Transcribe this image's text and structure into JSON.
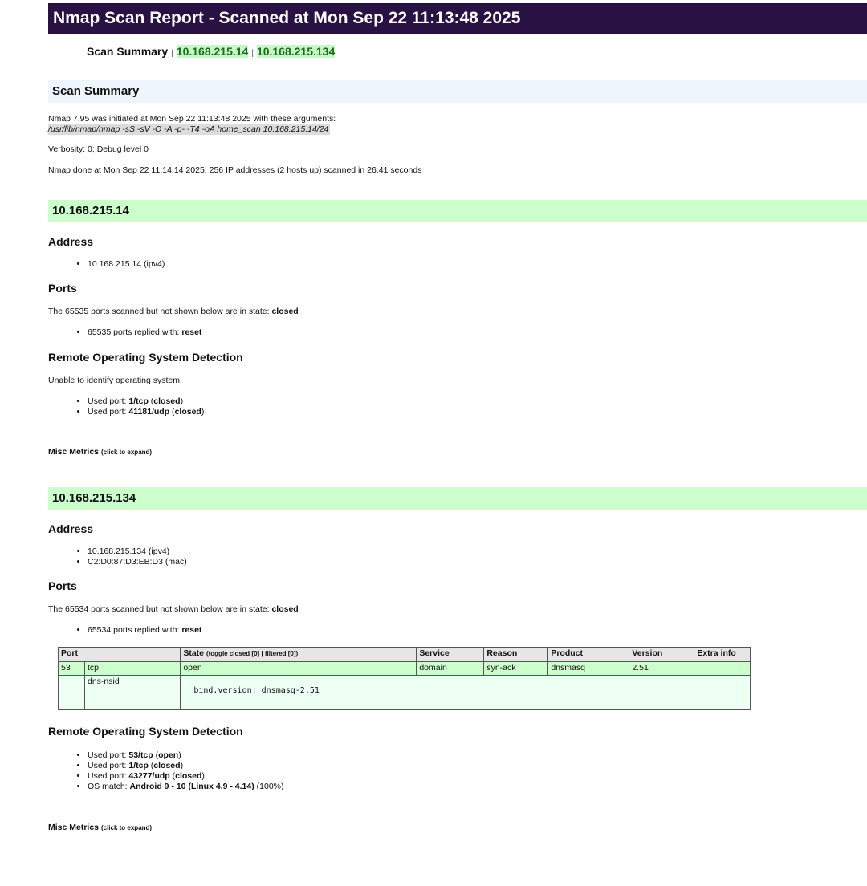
{
  "title": "Nmap Scan Report - Scanned at Mon Sep 22 11:13:48 2025",
  "nav": {
    "summary": "Scan Summary",
    "sep": "|",
    "hosts": [
      "10.168.215.14",
      "10.168.215.134"
    ]
  },
  "summary": {
    "heading": "Scan Summary",
    "line1": "Nmap 7.95 was initiated at Mon Sep 22 11:13:48 2025 with these arguments:",
    "args": "/usr/lib/nmap/nmap -sS -sV -O -A -p- -T4 -oA home_scan 10.168.215.14/24",
    "verbosity": "Verbosity: 0; Debug level 0",
    "done": "Nmap done at Mon Sep 22 11:14:14 2025; 256 IP addresses (2 hosts up) scanned in 26.41 seconds"
  },
  "host1": {
    "heading": "10.168.215.14",
    "address_title": "Address",
    "addresses": [
      "10.168.215.14 (ipv4)"
    ],
    "ports_title": "Ports",
    "ports_text": "The 65535 ports scanned but not shown below are in state: ",
    "ports_state": "closed",
    "replied_text": "65535 ports replied with: ",
    "replied_value": "reset",
    "os_title": "Remote Operating System Detection",
    "os_text": "Unable to identify operating system.",
    "used_ports": [
      {
        "prefix": "Used port: ",
        "port": "1/tcp",
        "state": "closed"
      },
      {
        "prefix": "Used port: ",
        "port": "41181/udp",
        "state": "closed"
      }
    ],
    "misc": "Misc Metrics",
    "misc_hint": "(click to expand)"
  },
  "host2": {
    "heading": "10.168.215.134",
    "address_title": "Address",
    "addresses": [
      "10.168.215.134 (ipv4)",
      "C2:D0:87:D3:EB:D3 (mac)"
    ],
    "ports_title": "Ports",
    "ports_text": "The 65534 ports scanned but not shown below are in state: ",
    "ports_state": "closed",
    "replied_text": "65534 ports replied with: ",
    "replied_value": "reset",
    "table": {
      "headers": {
        "port": "Port",
        "state": "State",
        "toggle": "(toggle closed [0] | filtered [0])",
        "service": "Service",
        "reason": "Reason",
        "product": "Product",
        "version": "Version",
        "extra": "Extra info"
      },
      "row": {
        "port": "53",
        "proto": "tcp",
        "state": "open",
        "service": "domain",
        "reason": "syn-ack",
        "product": "dnsmasq",
        "version": "2.51",
        "extra": ""
      },
      "script": {
        "name": "dns-nsid",
        "output": "bind.version: dnsmasq-2.51"
      }
    },
    "os_title": "Remote Operating System Detection",
    "used_ports": [
      {
        "prefix": "Used port: ",
        "port": "53/tcp",
        "state": "open"
      },
      {
        "prefix": "Used port: ",
        "port": "1/tcp",
        "state": "closed"
      },
      {
        "prefix": "Used port: ",
        "port": "43277/udp",
        "state": "closed"
      }
    ],
    "os_match": {
      "prefix": "OS match: ",
      "name": "Android 9 - 10 (Linux 4.9 - 4.14)",
      "accuracy": "(100%)"
    },
    "misc": "Misc Metrics",
    "misc_hint": "(click to expand)"
  }
}
